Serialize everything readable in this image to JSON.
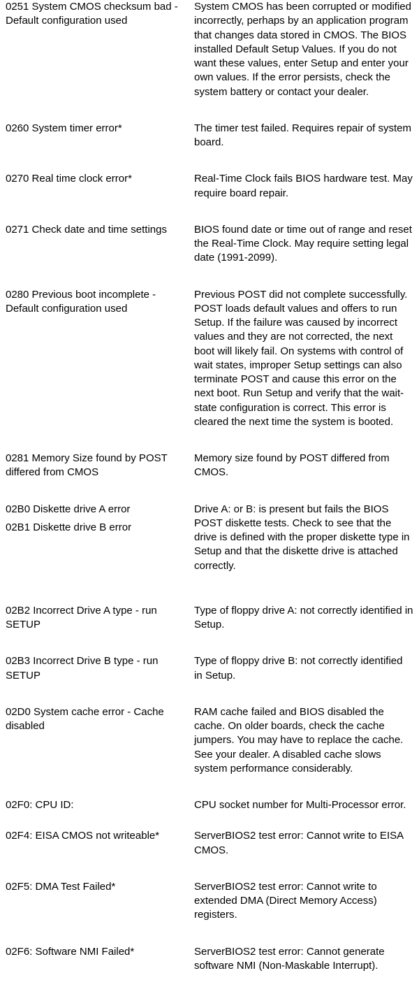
{
  "rows": [
    {
      "code": "0251 System CMOS checksum bad - Default configuration used",
      "desc": "System CMOS has been corrupted or modified incorrectly, perhaps by an application program that changes data stored in CMOS. The BIOS installed Default Setup Values. If you do not want these values, enter Setup and enter your own values.  If the error persists, check the system battery or contact your dealer."
    },
    {
      "code": "0260 System timer error*",
      "desc": "The timer test failed. Requires repair of system board."
    },
    {
      "code": "0270 Real time clock error*",
      "desc": "Real-Time Clock fails BIOS hardware test. May require board repair."
    },
    {
      "code": "0271 Check date and time settings",
      "desc": "BIOS found date or time out of range and reset the Real-Time Clock. May require setting legal date (1991-2099)."
    },
    {
      "code": "0280 Previous boot incomplete - Default configuration used",
      "desc": "Previous POST did not complete successfully. POST loads default values and offers to run Setup. If the failure was caused by incorrect values and they are not corrected, the next boot will likely fail. On systems with control of wait states, improper Setup settings can also terminate POST and cause this error on the next boot. Run Setup and verify that the wait-state configuration is correct. This error is cleared the next time the system is booted."
    },
    {
      "code": "0281 Memory Size found by POST differed from CMOS",
      "desc": "Memory size found by POST differed from CMOS."
    },
    {
      "code": "02B0 Diskette drive A error",
      "code2": "02B1 Diskette drive B error",
      "desc": "Drive A: or B: is present but fails the BIOS POST diskette tests. Check to see that the drive is defined with the proper diskette type in Setup and that the diskette drive is attached correctly."
    },
    {
      "code": "02B2 Incorrect Drive A type - run SETUP",
      "desc": "Type of floppy drive A: not correctly identified in Setup."
    },
    {
      "code": "02B3 Incorrect Drive B type - run SETUP",
      "desc": "Type of floppy drive B: not correctly identified in Setup."
    },
    {
      "code": "02D0 System cache error - Cache disabled",
      "desc": "RAM cache failed and BIOS disabled the cache. On older boards, check the cache jumpers. You may have to replace the cache. See your dealer. A disabled cache slows system performance considerably."
    },
    {
      "code": "02F0: CPU ID:",
      "desc": "CPU socket number for Multi-Processor error."
    },
    {
      "code": "02F4: EISA CMOS not writeable*",
      "desc": "ServerBIOS2 test error:  Cannot write to EISA CMOS."
    },
    {
      "code": "02F5: DMA Test Failed*",
      "desc": "ServerBIOS2 test error: Cannot write to extended DMA (Direct Memory Access) registers."
    },
    {
      "code": "02F6: Software NMI Failed*",
      "desc": "ServerBIOS2 test error:  Cannot generate software NMI (Non-Maskable Interrupt)."
    }
  ]
}
